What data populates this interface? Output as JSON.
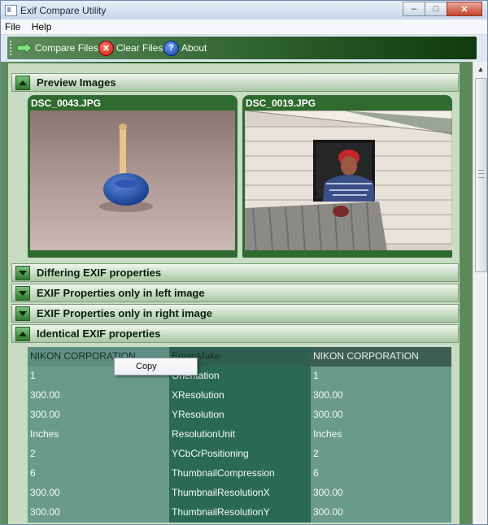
{
  "window": {
    "title": "Exif Compare Utility",
    "buttons": {
      "minimize": "–",
      "maximize": "□",
      "close": "✕"
    }
  },
  "menu": {
    "items": [
      "File",
      "Help"
    ]
  },
  "toolbar": {
    "buttons": [
      {
        "label": "Compare Files",
        "icon": "green-arrow-icon"
      },
      {
        "label": "Clear Files",
        "icon": "red-x-icon"
      },
      {
        "label": "About",
        "icon": "blue-question-icon"
      }
    ]
  },
  "sections": {
    "preview": {
      "label": "Preview Images",
      "expanded": true
    },
    "differing": {
      "label": "Differing EXIF properties",
      "expanded": false
    },
    "left_only": {
      "label": "EXIF Properties only in left image",
      "expanded": false
    },
    "right_only": {
      "label": "EXIF Properties only in right image",
      "expanded": false
    },
    "identical": {
      "label": "Identical EXIF properties",
      "expanded": true
    }
  },
  "previews": [
    {
      "filename": "DSC_0043.JPG"
    },
    {
      "filename": "DSC_0019.JPG"
    }
  ],
  "identical_table": {
    "rows": [
      [
        "NIKON CORPORATION",
        "EquipMake",
        "NIKON CORPORATION"
      ],
      [
        "1",
        "Orientation",
        "1"
      ],
      [
        "300.00",
        "XResolution",
        "300.00"
      ],
      [
        "300.00",
        "YResolution",
        "300.00"
      ],
      [
        "Inches",
        "ResolutionUnit",
        "Inches"
      ],
      [
        "2",
        "YCbCrPositioning",
        "2"
      ],
      [
        "6",
        "ThumbnailCompression",
        "6"
      ],
      [
        "300.00",
        "ThumbnailResolutionX",
        "300.00"
      ],
      [
        "300.00",
        "ThumbnailResolutionY",
        "300.00"
      ]
    ]
  },
  "context_menu": {
    "items": [
      "Copy"
    ]
  },
  "colors": {
    "accent_green": "#2f6a2f",
    "header_text": "#0b1f0b",
    "table_key": "#2a6a55",
    "table_value": "#6a9b8a"
  }
}
